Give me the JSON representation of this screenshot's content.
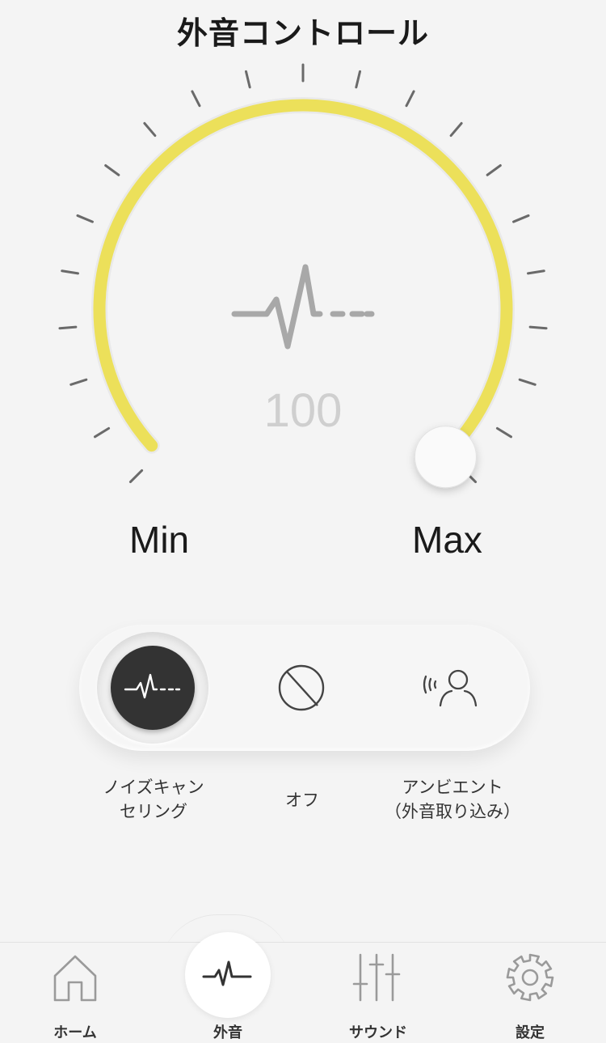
{
  "header": {
    "title": "外音コントロール"
  },
  "dial": {
    "value": "100",
    "min_label": "Min",
    "max_label": "Max",
    "level_fraction": 1.0,
    "accent_color": "#ece05a",
    "center_icon": "noise-wave-icon"
  },
  "modes": {
    "selected": "noise-cancelling",
    "options": [
      {
        "id": "noise-cancelling",
        "icon": "noise-wave-icon",
        "label": "ノイズキャン\nセリング"
      },
      {
        "id": "off",
        "icon": "off-circle-slash-icon",
        "label": "オフ"
      },
      {
        "id": "ambient",
        "icon": "ambient-person-icon",
        "label": "アンビエント\n（外音取り込み）"
      }
    ]
  },
  "tabbar": {
    "items": [
      {
        "icon": "home-icon",
        "label": "ホーム"
      },
      {
        "icon": "wave-icon",
        "label": "外音",
        "active": true
      },
      {
        "icon": "equalizer-sliders-icon",
        "label": "サウンド"
      },
      {
        "icon": "gear-icon",
        "label": "設定"
      }
    ]
  }
}
